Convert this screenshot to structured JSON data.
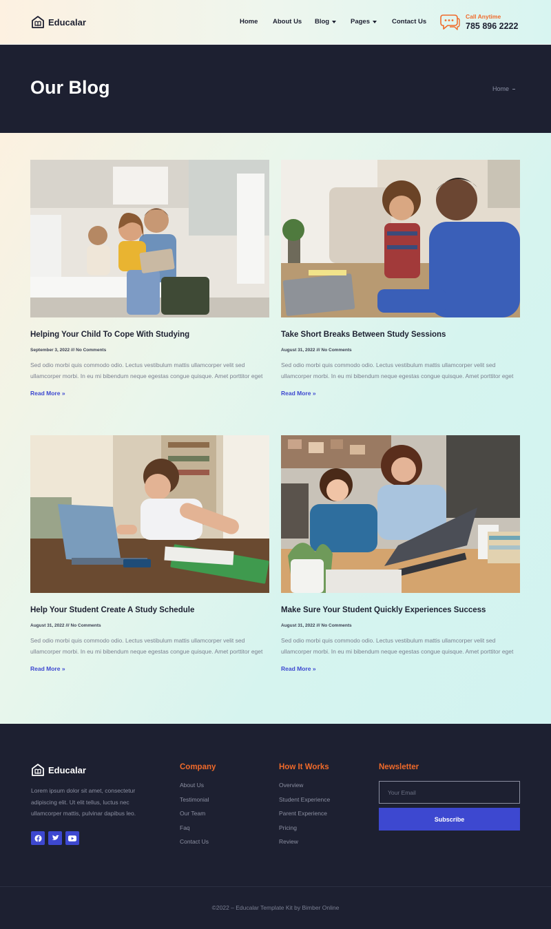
{
  "header": {
    "brand": "Educalar",
    "nav": [
      {
        "label": "Home",
        "has_caret": false
      },
      {
        "label": "About Us",
        "has_caret": false
      },
      {
        "label": "Blog",
        "has_caret": true
      },
      {
        "label": "Pages",
        "has_caret": true
      },
      {
        "label": "Contact Us",
        "has_caret": false
      }
    ],
    "call_label": "Call Anytime",
    "call_number": "785 896 2222",
    "call_icon": "chat-bubble-icon"
  },
  "banner": {
    "title": "Our Blog",
    "breadcrumb": "Home"
  },
  "posts": [
    {
      "title": "Helping Your Child To Cope With Studying",
      "date": "September 3, 2022",
      "separator": "///",
      "comments": "No Comments",
      "excerpt": "Sed odio morbi quis commodo odio. Lectus vestibulum mattis ullamcorper velit sed ullamcorper morbi. In eu mi bibendum neque egestas congue quisque. Amet porttitor eget",
      "read_more": "Read More »",
      "image": "family-with-tablet-photo"
    },
    {
      "title": "Take Short Breaks Between Study Sessions",
      "date": "August 31, 2022",
      "separator": "///",
      "comments": "No Comments",
      "excerpt": "Sed odio morbi quis commodo odio. Lectus vestibulum mattis ullamcorper velit sed ullamcorper morbi. In eu mi bibendum neque egestas congue quisque. Amet porttitor eget",
      "read_more": "Read More »",
      "image": "tutor-and-boy-photo"
    },
    {
      "title": "Help Your Student Create A Study Schedule",
      "date": "August 31, 2022",
      "separator": "///",
      "comments": "No Comments",
      "excerpt": "Sed odio morbi quis commodo odio. Lectus vestibulum mattis ullamcorper velit sed ullamcorper morbi. In eu mi bibendum neque egestas congue quisque. Amet porttitor eget",
      "read_more": "Read More »",
      "image": "girl-with-laptop-photo"
    },
    {
      "title": "Make Sure Your Student Quickly Experiences Success",
      "date": "August 31, 2022",
      "separator": "///",
      "comments": "No Comments",
      "excerpt": "Sed odio morbi quis commodo odio. Lectus vestibulum mattis ullamcorper velit sed ullamcorper morbi. In eu mi bibendum neque egestas congue quisque. Amet porttitor eget",
      "read_more": "Read More »",
      "image": "mother-and-son-laptop-photo"
    }
  ],
  "footer": {
    "brand": "Educalar",
    "about": "Lorem ipsum dolor sit amet, consectetur adipiscing elit. Ut elit tellus, luctus nec ullamcorper mattis, pulvinar dapibus leo.",
    "socials": [
      "facebook-icon",
      "twitter-icon",
      "youtube-icon"
    ],
    "company": {
      "title": "Company",
      "links": [
        "About Us",
        "Testimonial",
        "Our Team",
        "Faq",
        "Contact Us"
      ]
    },
    "how_it_works": {
      "title": "How It Works",
      "links": [
        "Overview",
        "Student Experience",
        "Parent Experience",
        "Pricing",
        "Review"
      ]
    },
    "newsletter": {
      "title": "Newsletter",
      "placeholder": "Your Email",
      "button": "Subscribe"
    },
    "copyright": "©2022 – Educalar Template Kit by Bimber Online"
  },
  "colors": {
    "dark": "#1d2031",
    "accent_orange": "#f06a2a",
    "accent_blue": "#3d48d0"
  }
}
